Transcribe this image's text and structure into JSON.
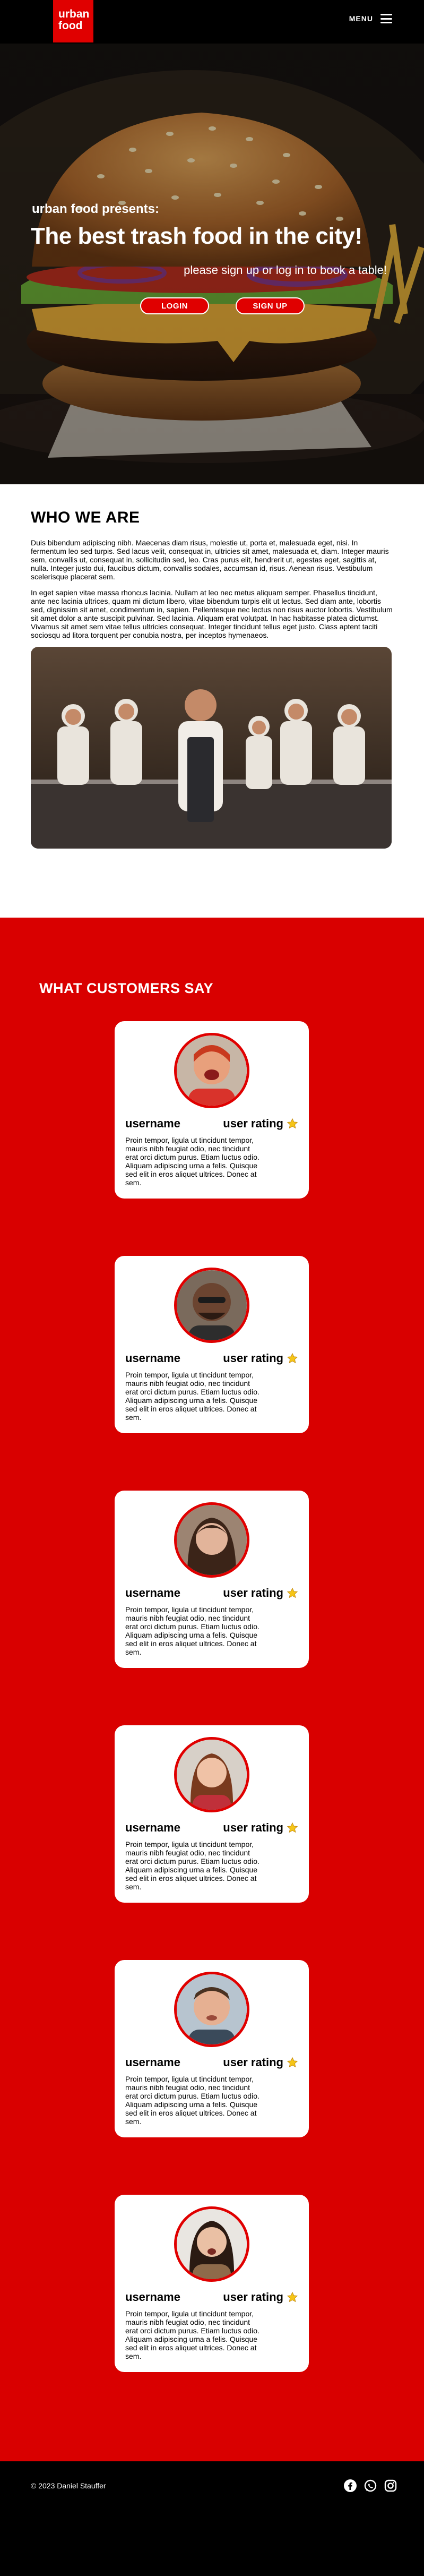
{
  "nav": {
    "logo_line1": "urban",
    "logo_line2": "food",
    "menu_label": "MENU"
  },
  "hero": {
    "kicker": "urban food presents:",
    "title": "The best trash food in the city!",
    "subtitle": "please sign up or log in to book a table!",
    "login_label": "LOGIN",
    "signup_label": "SIGN UP"
  },
  "about": {
    "heading": "WHO WE ARE",
    "paragraph1": "Duis bibendum adipiscing nibh. Maecenas diam risus, molestie ut, porta et, malesuada eget, nisi. In fermentum leo sed turpis. Sed lacus velit, consequat in, ultricies sit amet, malesuada et, diam. Integer mauris sem, convallis ut, consequat in, sollicitudin sed, leo. Cras purus elit, hendrerit ut, egestas eget, sagittis at, nulla. Integer justo dui, faucibus dictum, convallis sodales, accumsan id, risus. Aenean risus. Vestibulum scelerisque placerat sem.",
    "paragraph2": "In eget sapien vitae massa rhoncus lacinia. Nullam at leo nec metus aliquam semper. Phasellus tincidunt, ante nec lacinia ultrices, quam mi dictum libero, vitae bibendum turpis elit ut lectus. Sed diam ante, lobortis sed, dignissim sit amet, condimentum in, sapien. Pellentesque nec lectus non risus auctor lobortis. Vestibulum sit amet dolor a ante suscipit pulvinar. Sed lacinia. Aliquam erat volutpat. In hac habitasse platea dictumst. Vivamus sit amet sem vitae tellus ultricies consequat. Integer tincidunt tellus eget justo. Class aptent taciti sociosqu ad litora torquent per conubia nostra, per inceptos hymenaeos."
  },
  "reviews": {
    "heading": "WHAT CUSTOMERS SAY",
    "items": [
      {
        "username": "username",
        "rating_label": "user rating",
        "text": "Proin tempor, ligula ut tincidunt tempor, mauris nibh feugiat odio, nec tincidunt erat orci dictum purus. Etiam luctus odio. Aliquam adipiscing urna a felis. Quisque sed elit in eros aliquet ultrices. Donec at sem."
      },
      {
        "username": "username",
        "rating_label": "user rating",
        "text": "Proin tempor, ligula ut tincidunt tempor, mauris nibh feugiat odio, nec tincidunt erat orci dictum purus. Etiam luctus odio. Aliquam adipiscing urna a felis. Quisque sed elit in eros aliquet ultrices. Donec at sem."
      },
      {
        "username": "username",
        "rating_label": "user rating",
        "text": "Proin tempor, ligula ut tincidunt tempor, mauris nibh feugiat odio, nec tincidunt erat orci dictum purus. Etiam luctus odio. Aliquam adipiscing urna a felis. Quisque sed elit in eros aliquet ultrices. Donec at sem."
      },
      {
        "username": "username",
        "rating_label": "user rating",
        "text": "Proin tempor, ligula ut tincidunt tempor, mauris nibh feugiat odio, nec tincidunt erat orci dictum purus. Etiam luctus odio. Aliquam adipiscing urna a felis. Quisque sed elit in eros aliquet ultrices. Donec at sem."
      },
      {
        "username": "username",
        "rating_label": "user rating",
        "text": "Proin tempor, ligula ut tincidunt tempor, mauris nibh feugiat odio, nec tincidunt erat orci dictum purus. Etiam luctus odio. Aliquam adipiscing urna a felis. Quisque sed elit in eros aliquet ultrices. Donec at sem."
      },
      {
        "username": "username",
        "rating_label": "user rating",
        "text": "Proin tempor, ligula ut tincidunt tempor, mauris nibh feugiat odio, nec tincidunt erat orci dictum purus. Etiam luctus odio. Aliquam adipiscing urna a felis. Quisque sed elit in eros aliquet ultrices. Donec at sem."
      }
    ]
  },
  "footer": {
    "copyright": "© 2023 Daniel Stauffer",
    "icons": [
      "facebook-icon",
      "whatsapp-icon",
      "instagram-icon"
    ]
  },
  "colors": {
    "brand_red": "#e00000",
    "section_red": "#d90000",
    "star_yellow": "#f5c518",
    "dark": "#000000"
  }
}
